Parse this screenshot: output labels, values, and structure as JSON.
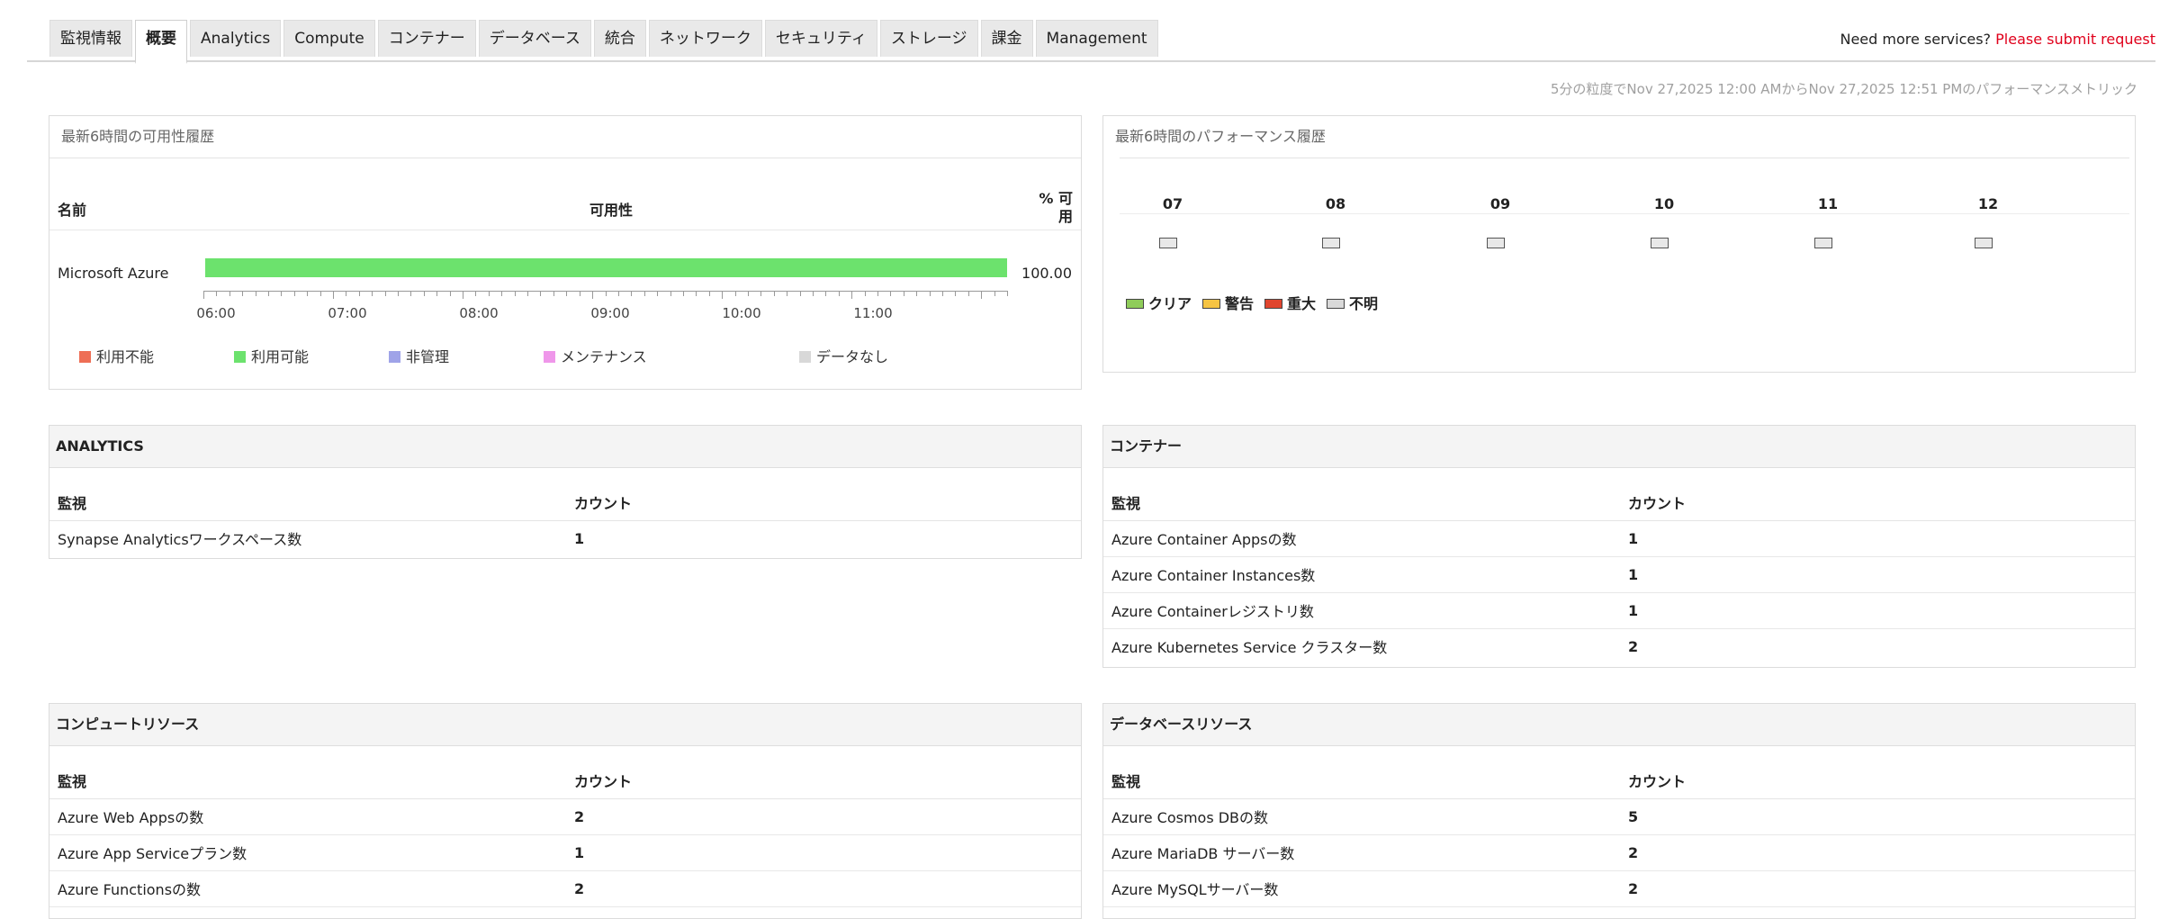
{
  "tabs": [
    "監視情報",
    "概要",
    "Analytics",
    "Compute",
    "コンテナー",
    "データベース",
    "統合",
    "ネットワーク",
    "セキュリティ",
    "ストレージ",
    "課金",
    "Management"
  ],
  "active_tab": "概要",
  "more_services": {
    "text": "Need more services?",
    "link": "Please submit request"
  },
  "range_note": "5分の粒度でNov 27,2025 12:00 AMからNov 27,2025 12:51 PMのパフォーマンスメトリック",
  "availability": {
    "title": "最新6時間の可用性履歴",
    "col_name": "名前",
    "col_avail": "可用性",
    "col_pct": "% 可用",
    "row": {
      "name": "Microsoft Azure",
      "pct": "100.00",
      "available_fraction": 1.0
    },
    "axis": [
      "06:00",
      "07:00",
      "08:00",
      "09:00",
      "10:00",
      "11:00"
    ],
    "legend": [
      {
        "label": "利用不能",
        "color": "#ee6e55"
      },
      {
        "label": "利用可能",
        "color": "#6ce26d"
      },
      {
        "label": "非管理",
        "color": "#9fa3e8"
      },
      {
        "label": "メンテナンス",
        "color": "#ef97ea"
      },
      {
        "label": "データなし",
        "color": "#d8d8d8"
      }
    ]
  },
  "performance": {
    "title": "最新6時間のパフォーマンス履歴",
    "hours": [
      "07",
      "08",
      "09",
      "10",
      "11",
      "12"
    ],
    "legend": [
      {
        "label": "クリア",
        "color": "#8fcc5a"
      },
      {
        "label": "警告",
        "color": "#f6c443"
      },
      {
        "label": "重大",
        "color": "#e0452e"
      },
      {
        "label": "不明",
        "color": "#d9d9d9"
      }
    ]
  },
  "analytics": {
    "title": "ANALYTICS",
    "headers": [
      "監視",
      "カウント"
    ],
    "rows": [
      [
        "Synapse Analyticsワークスペース数",
        "1"
      ]
    ]
  },
  "container": {
    "title": "コンテナー",
    "headers": [
      "監視",
      "カウント"
    ],
    "rows": [
      [
        "Azure Container Appsの数",
        "1"
      ],
      [
        "Azure Container Instances数",
        "1"
      ],
      [
        "Azure Containerレジストリ数",
        "1"
      ],
      [
        "Azure Kubernetes Service クラスター数",
        "2"
      ]
    ]
  },
  "compute": {
    "title": "コンピュートリソース",
    "headers": [
      "監視",
      "カウント"
    ],
    "rows": [
      [
        "Azure Web Appsの数",
        "2"
      ],
      [
        "Azure App Serviceプラン数",
        "1"
      ],
      [
        "Azure Functionsの数",
        "2"
      ]
    ]
  },
  "database": {
    "title": "データベースリソース",
    "headers": [
      "監視",
      "カウント"
    ],
    "rows": [
      [
        "Azure Cosmos DBの数",
        "5"
      ],
      [
        "Azure MariaDB サーバー数",
        "2"
      ],
      [
        "Azure MySQLサーバー数",
        "2"
      ]
    ]
  }
}
